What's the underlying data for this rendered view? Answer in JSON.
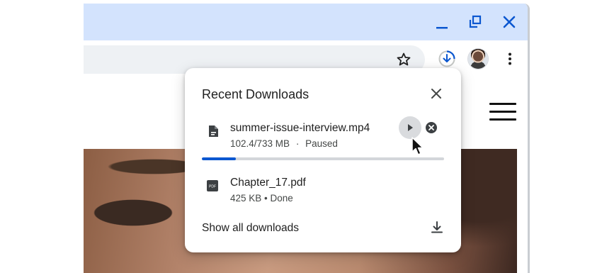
{
  "downloads": {
    "title": "Recent Downloads",
    "items": [
      {
        "name": "summer-issue-interview.mp4",
        "size": "102.4/733 MB",
        "separator": "·",
        "state": "Paused",
        "progress": 0.14,
        "icon": "file-icon"
      },
      {
        "name": "Chapter_17.pdf",
        "status": "425 KB • Done",
        "icon": "pdf-icon",
        "icon_text": "PDF"
      }
    ],
    "show_all": "Show all downloads"
  },
  "colors": {
    "titlebar": "#d3e3fd",
    "accent": "#0b57d0",
    "window_controls": "#0b57d0"
  }
}
